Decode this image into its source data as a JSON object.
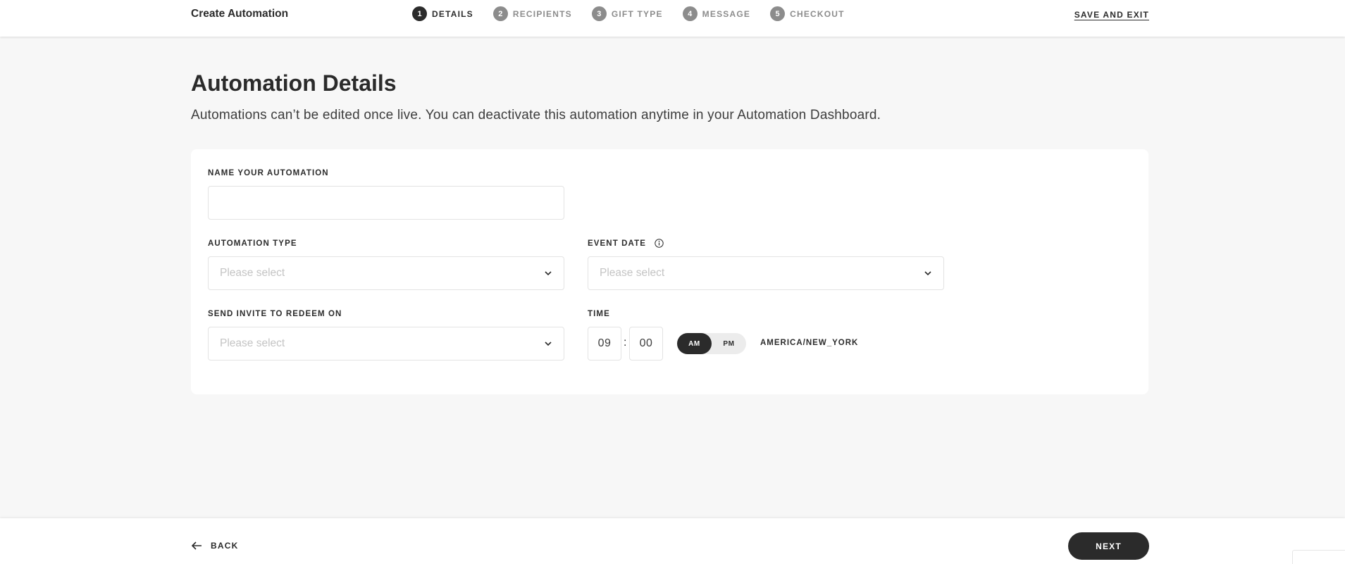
{
  "header": {
    "title": "Create Automation",
    "steps": [
      {
        "num": "1",
        "label": "DETAILS",
        "active": true
      },
      {
        "num": "2",
        "label": "RECIPIENTS",
        "active": false
      },
      {
        "num": "3",
        "label": "GIFT TYPE",
        "active": false
      },
      {
        "num": "4",
        "label": "MESSAGE",
        "active": false
      },
      {
        "num": "5",
        "label": "CHECKOUT",
        "active": false
      }
    ],
    "save_exit_label": "SAVE AND EXIT"
  },
  "main": {
    "title": "Automation Details",
    "subtitle": "Automations can’t be edited once live. You can deactivate this automation anytime in your Automation Dashboard."
  },
  "form": {
    "name": {
      "label": "NAME YOUR AUTOMATION",
      "value": ""
    },
    "type": {
      "label": "AUTOMATION TYPE",
      "placeholder": "Please select"
    },
    "event_date": {
      "label": "EVENT DATE",
      "placeholder": "Please select",
      "info_icon": "info-icon"
    },
    "send_on": {
      "label": "SEND INVITE TO REDEEM ON",
      "placeholder": "Please select"
    },
    "time": {
      "label": "TIME",
      "hour": "09",
      "separator": ":",
      "minute": "00",
      "am_label": "AM",
      "pm_label": "PM",
      "selected_period": "AM",
      "timezone": "AMERICA/NEW_YORK"
    }
  },
  "footer": {
    "back_label": "BACK",
    "next_label": "NEXT"
  },
  "colors": {
    "primary_dark": "#2b2b2b",
    "inactive_step": "#8c8c8c",
    "background": "#f7f7f7",
    "card": "#ffffff",
    "placeholder": "#c4c4c4"
  }
}
